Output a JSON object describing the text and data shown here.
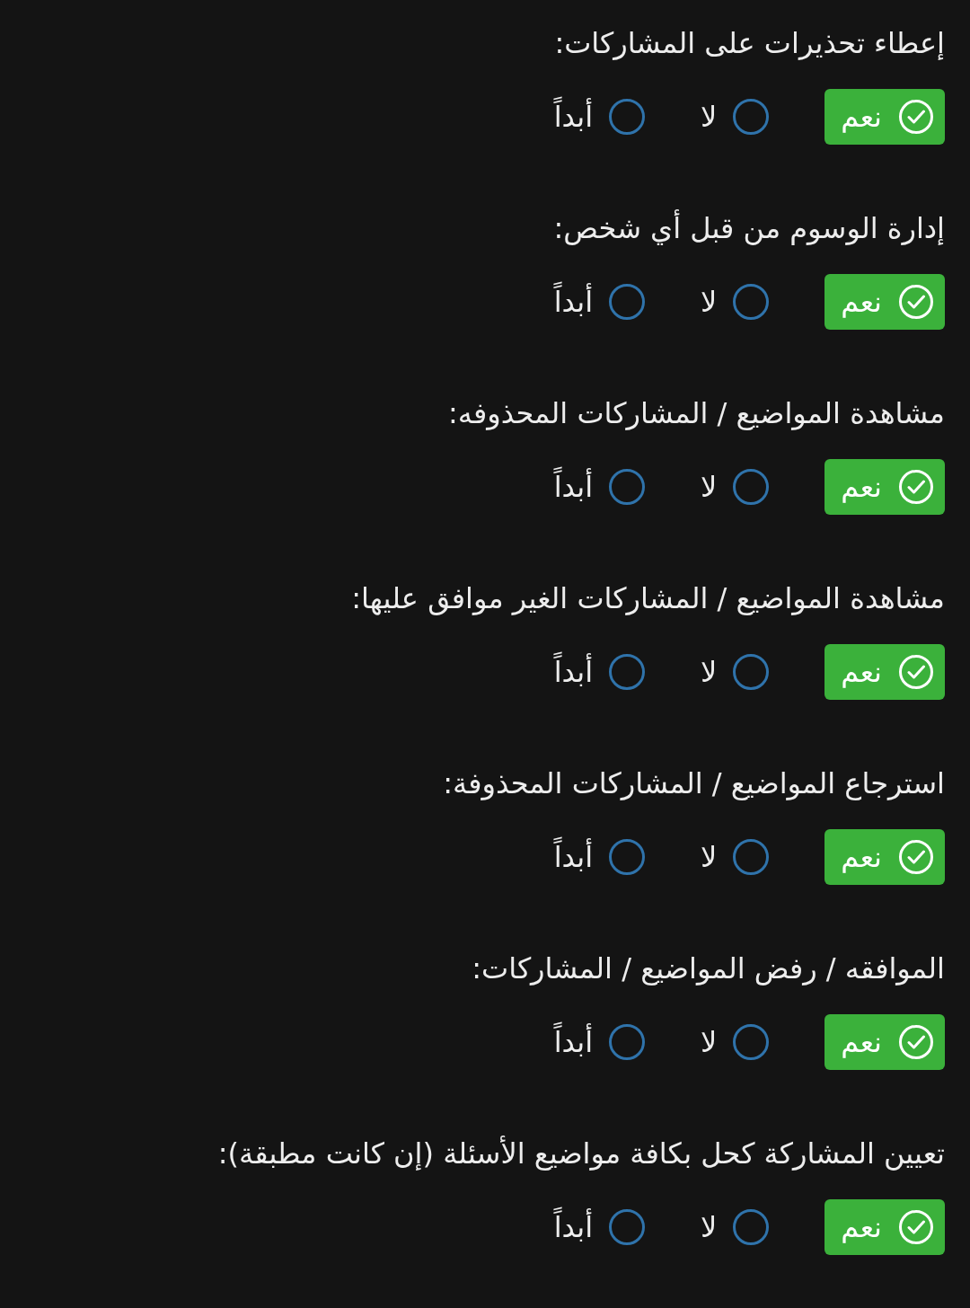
{
  "settings": [
    {
      "label": "إعطاء تحذيرات على المشاركات:",
      "options": [
        {
          "label": "نعم",
          "selected": true
        },
        {
          "label": "لا",
          "selected": false
        },
        {
          "label": "أبداً",
          "selected": false
        }
      ]
    },
    {
      "label": "إدارة الوسوم من قبل أي شخص:",
      "options": [
        {
          "label": "نعم",
          "selected": true
        },
        {
          "label": "لا",
          "selected": false
        },
        {
          "label": "أبداً",
          "selected": false
        }
      ]
    },
    {
      "label": "مشاهدة المواضيع / المشاركات المحذوفه:",
      "options": [
        {
          "label": "نعم",
          "selected": true
        },
        {
          "label": "لا",
          "selected": false
        },
        {
          "label": "أبداً",
          "selected": false
        }
      ]
    },
    {
      "label": "مشاهدة المواضيع / المشاركات الغير موافق عليها:",
      "options": [
        {
          "label": "نعم",
          "selected": true
        },
        {
          "label": "لا",
          "selected": false
        },
        {
          "label": "أبداً",
          "selected": false
        }
      ]
    },
    {
      "label": "استرجاع المواضيع / المشاركات المحذوفة:",
      "options": [
        {
          "label": "نعم",
          "selected": true
        },
        {
          "label": "لا",
          "selected": false
        },
        {
          "label": "أبداً",
          "selected": false
        }
      ]
    },
    {
      "label": "الموافقه / رفض المواضيع / المشاركات:",
      "options": [
        {
          "label": "نعم",
          "selected": true
        },
        {
          "label": "لا",
          "selected": false
        },
        {
          "label": "أبداً",
          "selected": false
        }
      ]
    },
    {
      "label": "تعيين المشاركة كحل بكافة مواضيع الأسئلة (إن كانت مطبقة):",
      "options": [
        {
          "label": "نعم",
          "selected": true
        },
        {
          "label": "لا",
          "selected": false
        },
        {
          "label": "أبداً",
          "selected": false
        }
      ]
    }
  ]
}
